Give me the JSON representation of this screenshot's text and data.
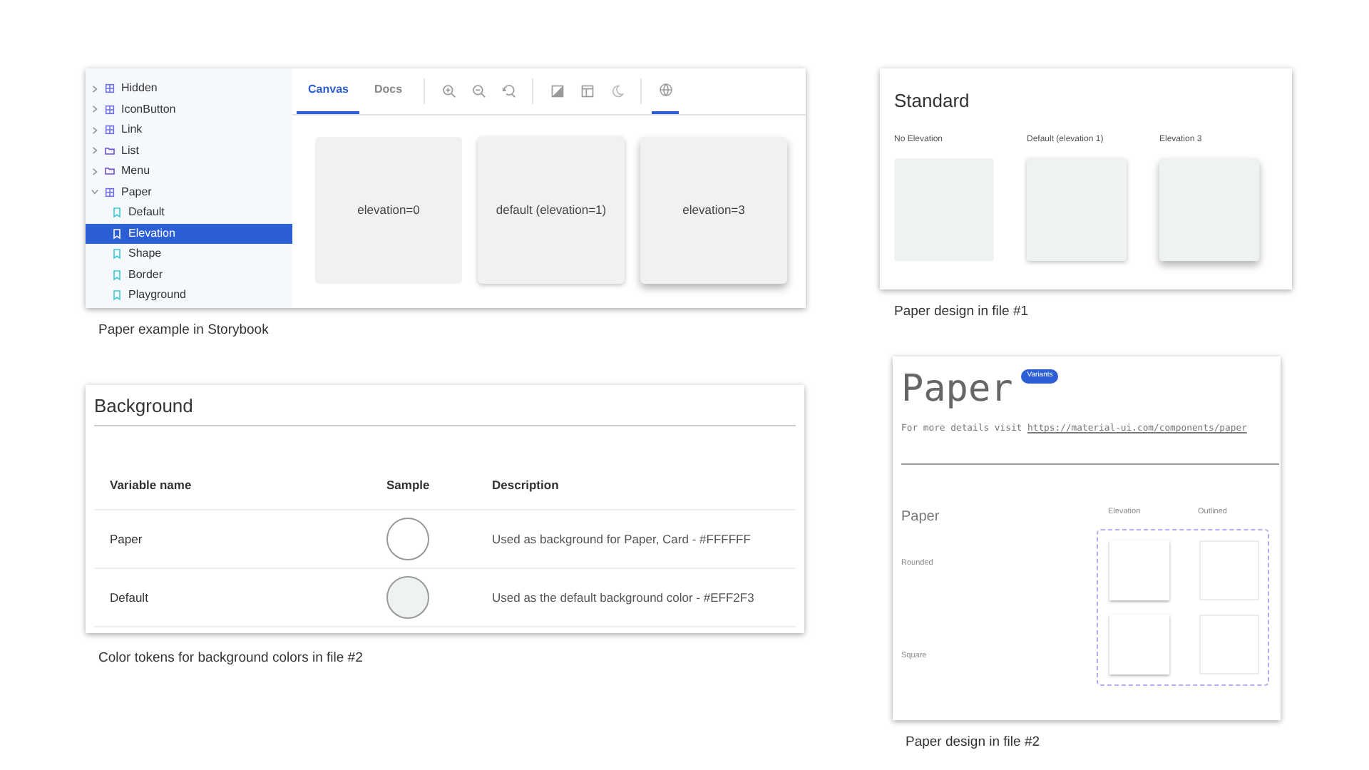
{
  "storybook": {
    "sidebar": {
      "items": [
        {
          "label": "Hidden",
          "kind": "component",
          "expanded": false,
          "selected": false
        },
        {
          "label": "IconButton",
          "kind": "component",
          "expanded": false,
          "selected": false
        },
        {
          "label": "Link",
          "kind": "component",
          "expanded": false,
          "selected": false
        },
        {
          "label": "List",
          "kind": "folder",
          "expanded": false,
          "selected": false
        },
        {
          "label": "Menu",
          "kind": "folder",
          "expanded": false,
          "selected": false
        },
        {
          "label": "Paper",
          "kind": "component",
          "expanded": true,
          "selected": false,
          "children": [
            {
              "label": "Default",
              "kind": "story",
              "selected": false
            },
            {
              "label": "Elevation",
              "kind": "story",
              "selected": true
            },
            {
              "label": "Shape",
              "kind": "story",
              "selected": false
            },
            {
              "label": "Border",
              "kind": "story",
              "selected": false
            },
            {
              "label": "Playground",
              "kind": "story",
              "selected": false
            }
          ]
        }
      ]
    },
    "tabs": [
      {
        "label": "Canvas",
        "selected": true
      },
      {
        "label": "Docs",
        "selected": false
      }
    ],
    "cards": [
      {
        "label": "elevation=0",
        "kind": "flat"
      },
      {
        "label": "default (elevation=1)",
        "kind": "raised"
      },
      {
        "label": "elevation=3",
        "kind": "lifted"
      }
    ],
    "caption": "Paper example in Storybook"
  },
  "file1": {
    "title": "Standard",
    "samples": [
      {
        "label": "No Elevation",
        "kind": "flat"
      },
      {
        "label": "Default (elevation 1)",
        "kind": "raised"
      },
      {
        "label": "Elevation 3",
        "kind": "lifted"
      }
    ],
    "caption": "Paper design in file #1"
  },
  "tokens": {
    "title": "Background",
    "columns": [
      "Variable name",
      "Sample",
      "Description"
    ],
    "rows": [
      {
        "name": "Paper",
        "color": "#ffffff",
        "description": "Used as background for Paper, Card - #FFFFFF"
      },
      {
        "name": "Default",
        "color": "#eff2f3",
        "description": "Used as the default background color - #EFF2F3"
      }
    ],
    "caption": "Color tokens for background colors in file #2"
  },
  "file2": {
    "title": "Paper",
    "badge": "Variants",
    "intro": "For more details visit",
    "link": "https://material-ui.com/components/paper",
    "section": "Paper",
    "columns": [
      "Elevation",
      "Outlined"
    ],
    "rows": [
      "Rounded",
      "Square"
    ],
    "caption": "Paper design in file #2"
  }
}
